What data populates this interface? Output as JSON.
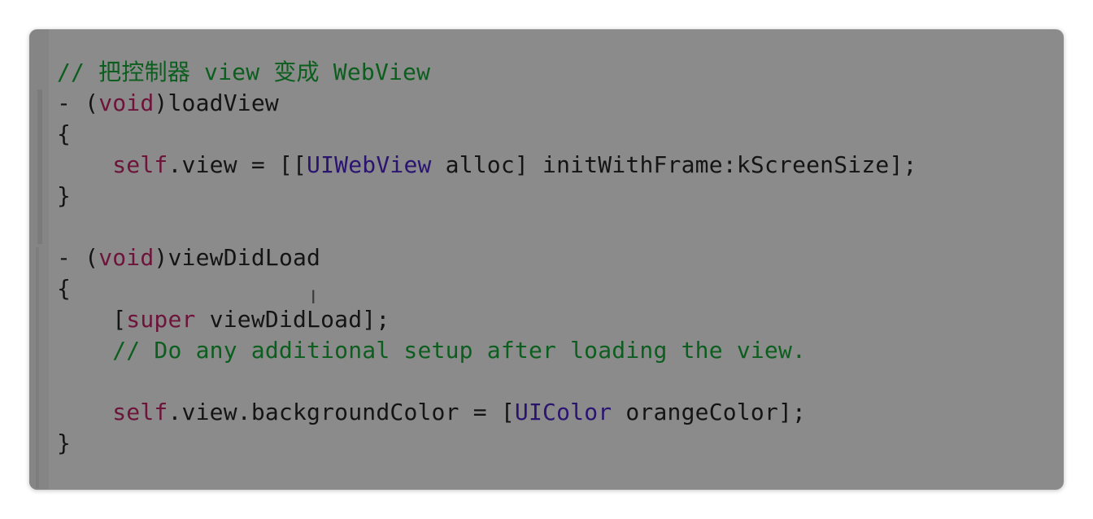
{
  "lines": [
    {
      "segments": [
        {
          "text": "// 把控制器 view 变成 WebView",
          "kind": "comment"
        }
      ]
    },
    {
      "segments": [
        {
          "text": "- (",
          "kind": "plain"
        },
        {
          "text": "void",
          "kind": "keyword"
        },
        {
          "text": ")loadView",
          "kind": "plain"
        }
      ]
    },
    {
      "segments": [
        {
          "text": "{",
          "kind": "plain"
        }
      ]
    },
    {
      "segments": [
        {
          "text": "    ",
          "kind": "plain"
        },
        {
          "text": "self",
          "kind": "keyword"
        },
        {
          "text": ".view = [[",
          "kind": "plain"
        },
        {
          "text": "UIWebView",
          "kind": "class"
        },
        {
          "text": " alloc] initWithFrame:kScreenSize];",
          "kind": "plain"
        }
      ]
    },
    {
      "segments": [
        {
          "text": "}",
          "kind": "plain"
        }
      ]
    },
    {
      "segments": [
        {
          "text": "",
          "kind": "plain"
        }
      ]
    },
    {
      "segments": [
        {
          "text": "- (",
          "kind": "plain"
        },
        {
          "text": "void",
          "kind": "keyword"
        },
        {
          "text": ")viewDidLoad",
          "kind": "plain"
        }
      ]
    },
    {
      "segments": [
        {
          "text": "{",
          "kind": "plain"
        }
      ]
    },
    {
      "segments": [
        {
          "text": "    [",
          "kind": "plain"
        },
        {
          "text": "super",
          "kind": "keyword"
        },
        {
          "text": " viewDidLoad];",
          "kind": "plain"
        }
      ]
    },
    {
      "segments": [
        {
          "text": "    // Do any additional setup after loading the view.",
          "kind": "comment"
        }
      ]
    },
    {
      "segments": [
        {
          "text": "",
          "kind": "plain"
        }
      ]
    },
    {
      "segments": [
        {
          "text": "    ",
          "kind": "plain"
        },
        {
          "text": "self",
          "kind": "keyword"
        },
        {
          "text": ".view.backgroundColor = [",
          "kind": "plain"
        },
        {
          "text": "UIColor",
          "kind": "class"
        },
        {
          "text": " orangeColor];",
          "kind": "plain"
        }
      ]
    },
    {
      "segments": [
        {
          "text": "}",
          "kind": "plain"
        }
      ]
    }
  ],
  "cursor_icon": "text-cursor-icon",
  "colors": {
    "background": "#8b8b8b",
    "comment": "#0c5e1e",
    "keyword": "#6c1439",
    "class": "#2a1470",
    "plain": "#141414"
  }
}
